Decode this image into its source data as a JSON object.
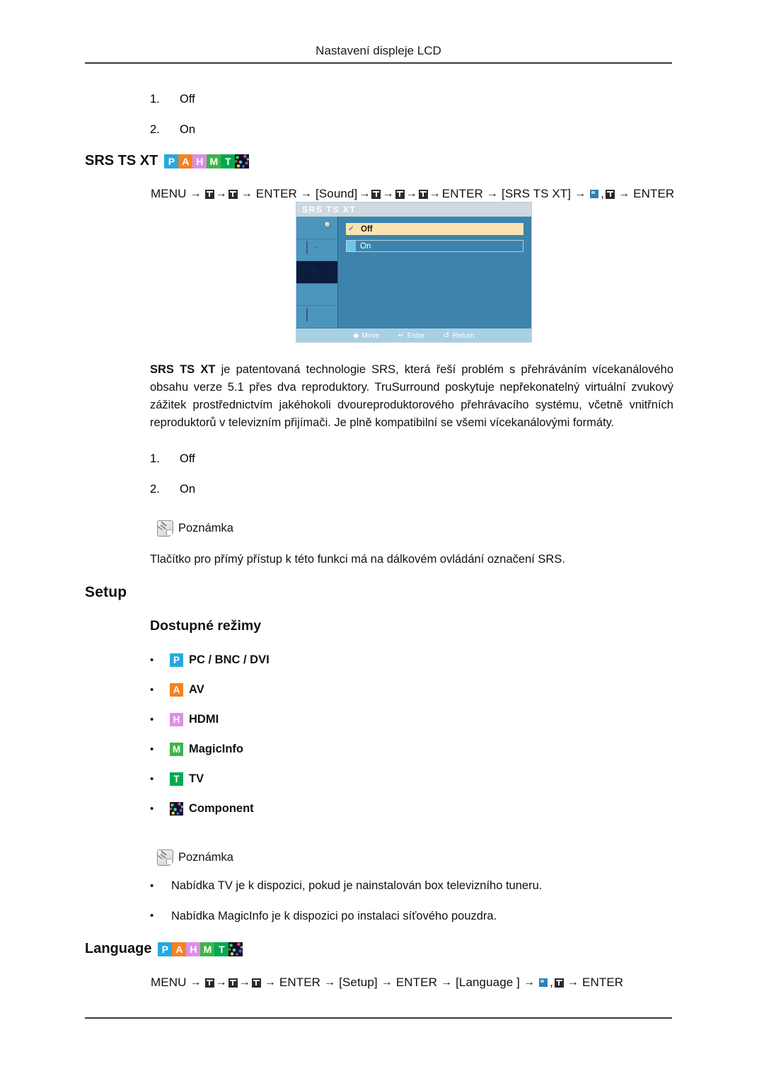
{
  "page": {
    "header_title": "Nastavení displeje LCD"
  },
  "top_list": {
    "items": [
      {
        "index": "1.",
        "label": "Off"
      },
      {
        "index": "2.",
        "label": "On"
      }
    ]
  },
  "srs_section": {
    "heading": "SRS TS XT",
    "badges": [
      {
        "letter": "P",
        "name": "pc-bnc-dvi-badge",
        "color": "#26a9e0"
      },
      {
        "letter": "A",
        "name": "av-badge",
        "color": "#f58220"
      },
      {
        "letter": "H",
        "name": "hdmi-badge",
        "color": "#dc8fe6"
      },
      {
        "letter": "M",
        "name": "magicinfo-badge",
        "color": "#3cb54a"
      },
      {
        "letter": "T",
        "name": "tv-badge",
        "color": "#00a94f"
      },
      {
        "letter": "",
        "name": "component-badge",
        "color": "#121019"
      }
    ],
    "nav": {
      "t1": "MENU",
      "t2": "ENTER",
      "t3": "[Sound]",
      "t4": "ENTER",
      "t5": "[SRS TS XT]",
      "comma": ",",
      "t6": "ENTER",
      "arrow": "→"
    },
    "paragraph_bold": "SRS TS XT",
    "paragraph_rest": " je patentovaná technologie SRS, která řeší problém s přehráváním vícekanálového obsahu verze 5.1 přes dva reproduktory. TruSurround poskytuje nepřekonatelný virtuální zvukový zážitek prostřednictvím jakéhokoli dvoureproduktorového přehrávacího systému, včetně vnitřních reproduktorů v televizním přijímači. Je plně kompatibilní se všemi vícekanálovými formáty.",
    "options": [
      {
        "index": "1.",
        "label": "Off"
      },
      {
        "index": "2.",
        "label": "On"
      }
    ],
    "note_label": "Poznámka",
    "note_text": "Tlačítko pro přímý přístup k této funkci má na dálkovém ovládání označení SRS."
  },
  "osd": {
    "title": "SRS TS XT",
    "sidebar_icons": [
      {
        "name": "picture-icon",
        "active": false
      },
      {
        "name": "image-adjust-icon",
        "active": false
      },
      {
        "name": "sound-icon",
        "active": true
      },
      {
        "name": "setup-gear-icon",
        "active": false
      },
      {
        "name": "multi-control-monitor-icon",
        "active": false
      }
    ],
    "rows": [
      {
        "label": "Off",
        "selected": true,
        "mark": "✓"
      },
      {
        "label": "On",
        "selected": false,
        "mark": ""
      }
    ],
    "footer": {
      "move": "Move",
      "enter": "Enter",
      "return": "Return",
      "move_icon": "◆",
      "enter_icon": "↵",
      "return_icon": "↺"
    }
  },
  "setup_section": {
    "heading": "Setup",
    "subheading": "Dostupné režimy",
    "bullet": "•",
    "modes": [
      {
        "badge": "P",
        "badge_class": "b-p",
        "label": "PC / BNC / DVI",
        "bold": true
      },
      {
        "badge": "A",
        "badge_class": "b-a",
        "label": "AV",
        "bold": true
      },
      {
        "badge": "H",
        "badge_class": "b-h",
        "label": "HDMI",
        "bold": true
      },
      {
        "badge": "M",
        "badge_class": "b-m",
        "label": "MagicInfo",
        "bold": true
      },
      {
        "badge": "T",
        "badge_class": "b-t",
        "label": "TV",
        "bold": true
      },
      {
        "badge": "",
        "badge_class": "b-c",
        "label": "Component",
        "bold": true
      }
    ],
    "note_label": "Poznámka",
    "notes": [
      "Nabídka TV je k dispozici, pokud je nainstalován box televizního tuneru.",
      "Nabídka MagicInfo je k dispozici po instalaci síťového pouzdra."
    ]
  },
  "language_section": {
    "heading": "Language",
    "nav": {
      "t1": "MENU",
      "t2": "ENTER",
      "t3": "[Setup]",
      "t4": "ENTER",
      "t5": "[Language ]",
      "comma": ",",
      "t6": "ENTER",
      "arrow": "→"
    }
  }
}
